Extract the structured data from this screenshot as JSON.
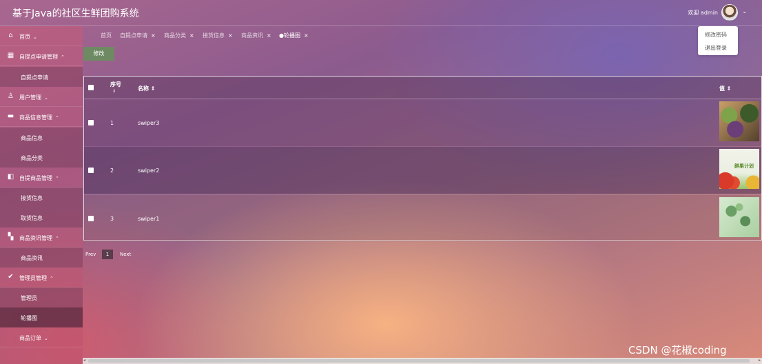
{
  "header": {
    "app_title": "基于Java的社区生鲜团购系统",
    "welcome": "欢迎 admin",
    "user_menu": [
      "修改密码",
      "退出登录"
    ]
  },
  "sidebar": {
    "items": [
      {
        "label": "首页",
        "icon": "home-icon"
      },
      {
        "label": "自提点申请管理",
        "icon": "store-icon"
      },
      {
        "label": "自提点申请",
        "sub": true
      },
      {
        "label": "用户管理",
        "icon": "user-icon"
      },
      {
        "label": "商品信息管理",
        "icon": "box-icon"
      },
      {
        "label": "商品信息",
        "sub": true
      },
      {
        "label": "商品分类",
        "sub": true
      },
      {
        "label": "自提商品管理",
        "icon": "panel-icon"
      },
      {
        "label": "接货信息",
        "sub": true
      },
      {
        "label": "取货信息",
        "sub": true
      },
      {
        "label": "商品资讯管理",
        "icon": "grid-icon"
      },
      {
        "label": "商品资讯",
        "sub": true
      },
      {
        "label": "管理员管理",
        "icon": "check-circle-icon"
      },
      {
        "label": "管理员",
        "sub": true
      },
      {
        "label": "轮播图",
        "sub": true,
        "active": true
      },
      {
        "label": "商品订单"
      }
    ]
  },
  "tabs": [
    {
      "label": "首页"
    },
    {
      "label": "自提点申请"
    },
    {
      "label": "商品分类"
    },
    {
      "label": "接货信息"
    },
    {
      "label": "商品资讯"
    },
    {
      "label": "●轮播图",
      "active": true
    }
  ],
  "toolbar": {
    "edit_label": "修改"
  },
  "table": {
    "headers": {
      "index": "序号",
      "name": "名称 ⇕",
      "image": "值 ⇕"
    },
    "index_sort": "⇕",
    "rows": [
      {
        "index": "1",
        "name": "swiper3",
        "image": "vegetables-photo"
      },
      {
        "index": "2",
        "name": "swiper2",
        "image": "tomatoes-banner",
        "image_text": "鲜果计划"
      },
      {
        "index": "3",
        "name": "swiper1",
        "image": "greens-photo"
      }
    ]
  },
  "pagination": {
    "prev": "Prev",
    "current": "1",
    "next": "Next"
  },
  "watermark": "CSDN @花椒coding",
  "colors": {
    "edit_button": "#6e8a63",
    "pager_active": "#5a3c4a"
  }
}
